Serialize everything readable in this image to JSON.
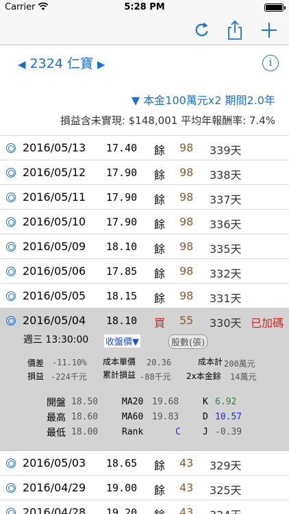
{
  "status": {
    "carrier": "Carrier",
    "time": "5:28 PM"
  },
  "stock": {
    "prev_arrow": "◀",
    "label": "2324 仁寶",
    "next_arrow": "▶",
    "info": "i"
  },
  "principal": "▼ 本金100萬元x2 期間2.0年",
  "summary": "損益含未實現: $148,001  平均年報酬率: 7.4%",
  "rows_before": [
    {
      "date": "2016/05/13",
      "price": "17.40",
      "act": "餘",
      "shares": "98",
      "days": "339天"
    },
    {
      "date": "2016/05/12",
      "price": "17.90",
      "act": "餘",
      "shares": "98",
      "days": "338天"
    },
    {
      "date": "2016/05/11",
      "price": "17.90",
      "act": "餘",
      "shares": "98",
      "days": "337天"
    },
    {
      "date": "2016/05/10",
      "price": "17.90",
      "act": "餘",
      "shares": "98",
      "days": "336天"
    },
    {
      "date": "2016/05/09",
      "price": "18.10",
      "act": "餘",
      "shares": "98",
      "days": "335天"
    },
    {
      "date": "2016/05/06",
      "price": "17.85",
      "act": "餘",
      "shares": "98",
      "days": "332天"
    },
    {
      "date": "2016/05/05",
      "price": "18.15",
      "act": "餘",
      "shares": "98",
      "days": "331天"
    }
  ],
  "selected": {
    "date": "2016/05/04",
    "price": "18.10",
    "act": "買",
    "shares": "55",
    "days": "330天",
    "flag": "已加碼"
  },
  "detail": {
    "weekday": "週三 13:30:00",
    "close_btn": "收盤價▼",
    "shares_btn": "股數(張)",
    "spread_label": "價差",
    "spread_value": "-11.10%",
    "unit_cost_label": "成本單價",
    "unit_cost_value": "20.36",
    "total_cost_label": "成本計",
    "total_cost_value": "200萬元",
    "pl_label": "損益",
    "pl_value": "-224千元",
    "cum_pl_label": "累計損益",
    "cum_pl_value": "-88千元",
    "remain_label": "2x本金餘",
    "remain_value": "14萬元",
    "open_label": "開盤",
    "open_value": "18.50",
    "high_label": "最高",
    "high_value": "18.60",
    "low_label": "最低",
    "low_value": "18.00",
    "ma20_label": "MA20",
    "ma20_value": "19.68",
    "ma60_label": "MA60",
    "ma60_value": "19.83",
    "rank_label": "Rank",
    "rank_value": "C",
    "k_label": "K",
    "k_value": "6.92",
    "d_label": "D",
    "d_value": "10.57",
    "j_label": "J",
    "j_value": "-0.39"
  },
  "rows_after": [
    {
      "date": "2016/05/03",
      "price": "18.65",
      "act": "餘",
      "shares": "43",
      "days": "329天"
    },
    {
      "date": "2016/04/29",
      "price": "19.00",
      "act": "餘",
      "shares": "43",
      "days": "325天"
    },
    {
      "date": "2016/04/28",
      "price": "19.20",
      "act": "餘",
      "shares": "43",
      "days": "324天"
    }
  ]
}
